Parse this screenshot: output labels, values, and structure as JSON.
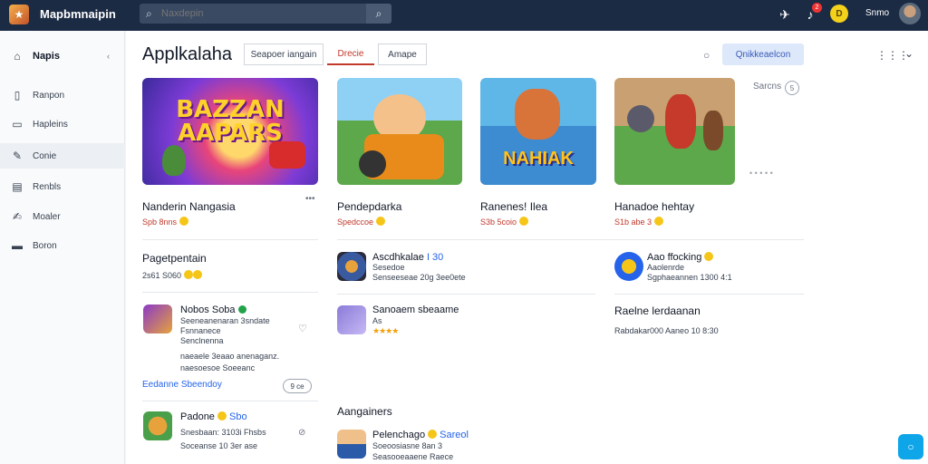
{
  "topbar": {
    "app_name": "Mapbmnaipin",
    "search_placeholder": "Naxdepin",
    "user_name": "Snmo",
    "notification_count": "2",
    "coin_glyph": "D"
  },
  "sidebar": {
    "items": [
      {
        "label": "Napis",
        "icon": "home-icon"
      },
      {
        "label": "Ranpon",
        "icon": "info-icon"
      },
      {
        "label": "Hapleins",
        "icon": "book-icon"
      },
      {
        "label": "Conie",
        "icon": "edit-icon"
      },
      {
        "label": "Renbls",
        "icon": "document-icon"
      },
      {
        "label": "Moaler",
        "icon": "pen-icon"
      },
      {
        "label": "Boron",
        "icon": "folder-icon"
      }
    ]
  },
  "main": {
    "title": "Applkalaha",
    "tabs": [
      "Seapoer iangain",
      "Drecie",
      "Amape"
    ],
    "active_tab": 1,
    "primary_button": "Qnikkeaelcon",
    "side_panel_label": "Sarcns",
    "side_panel_count": "5",
    "cards": [
      {
        "title": "Nanderin Nangasia",
        "meta": "Spb 8nns",
        "art_text": "BAZZAN AAPARS"
      },
      {
        "title": "Pendepdarka",
        "meta": "Spedccoe",
        "art_text": ""
      },
      {
        "title": "Ranenes! Ilea",
        "meta": "S3b 5coio",
        "art_text": "NAHIAK"
      },
      {
        "title": "Hanadoe hehtay",
        "meta": "S1b abe 3",
        "art_text": ""
      }
    ],
    "section_left": {
      "title": "Pagetpentain",
      "meta": "2s61 S060"
    },
    "left_list": [
      {
        "title": "Nobos Soba",
        "sub": [
          "Seeneanenaran 3sndate",
          "Fsnnanece",
          "Senclnenna"
        ],
        "sub2": "naeaele 3eaao anenaganz.",
        "sub3": "naesoesoe Soeeanc"
      },
      {
        "title": "Padone",
        "tag": "Sbo",
        "sub": [
          "Snesbaan: 3103i Fhsbs",
          "Soceanse 10 3er ase"
        ]
      }
    ],
    "left_link": "Eedanne Sbeendoy",
    "left_button": "9 ce",
    "mid_list": [
      {
        "title": "Ascdhkalae",
        "tag": "I 30",
        "sub": [
          "Sesedoe",
          "Senseeseae 20g 3ee0ete"
        ]
      },
      {
        "title": "Sanoaem sbeaame",
        "sub": [
          "As"
        ]
      }
    ],
    "right_list": [
      {
        "title": "Aao ffocking",
        "sub": [
          "Aaolenrde",
          "Sgphaeannen 1300 4:1"
        ]
      }
    ],
    "right_section": {
      "title": "Raelne lerdaanan",
      "meta": "Rabdakar000 Aaneo 10 8:30"
    },
    "bottom_section": {
      "title": "Aangainers"
    },
    "bottom_list": [
      {
        "title": "Pelenchago",
        "tag": "Sareol",
        "sub": [
          "Soeoosiasne 8an 3",
          "Seasooeaaene Raece"
        ]
      }
    ]
  },
  "colors": {
    "topbar": "#1c2b44",
    "accent_red": "#c0392b",
    "link_blue": "#2563eb",
    "fab": "#0ea5e9"
  }
}
